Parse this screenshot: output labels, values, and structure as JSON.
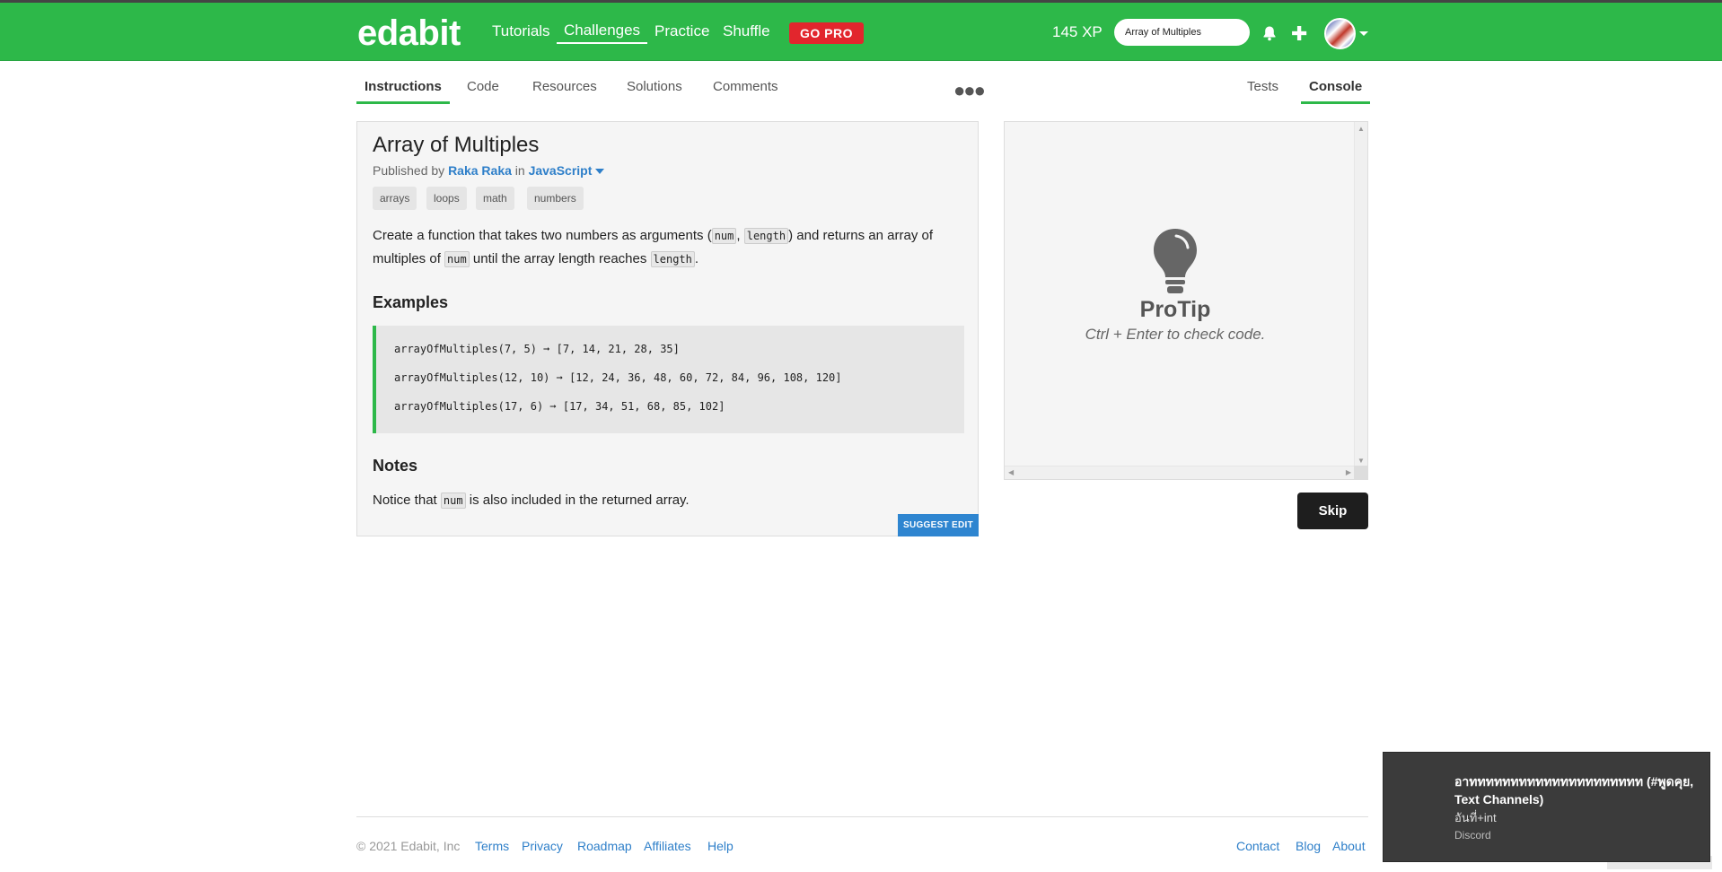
{
  "nav": {
    "logo": "edabit",
    "links": [
      "Tutorials",
      "Challenges",
      "Practice",
      "Shuffle"
    ],
    "active_link": "Challenges",
    "gopro": "GO PRO",
    "xp": "145 XP",
    "search_value": "Array of Multiples"
  },
  "tabs": {
    "left": [
      "Instructions",
      "Code",
      "Resources",
      "Solutions",
      "Comments"
    ],
    "right": [
      "Tests",
      "Console"
    ],
    "active_left": "Instructions",
    "active_right": "Console"
  },
  "challenge": {
    "title": "Array of Multiples",
    "published_prefix": "Published by",
    "author": "Raka Raka",
    "in_word": "in",
    "language": "JavaScript",
    "tags": [
      "arrays",
      "loops",
      "math",
      "numbers"
    ],
    "desc": {
      "p1": "Create a function that takes two numbers as arguments (",
      "c1": "num",
      "p2": ", ",
      "c2": "length",
      "p3": ") and returns an array of multiples of ",
      "c3": "num",
      "p4": " until the array length reaches ",
      "c4": "length",
      "p5": "."
    },
    "examples_heading": "Examples",
    "examples": [
      "arrayOfMultiples(7, 5) ➞ [7, 14, 21, 28, 35]",
      "arrayOfMultiples(12, 10) ➞ [12, 24, 36, 48, 60, 72, 84, 96, 108, 120]",
      "arrayOfMultiples(17, 6) ➞ [17, 34, 51, 68, 85, 102]"
    ],
    "notes_heading": "Notes",
    "notes": {
      "p1": "Notice that ",
      "c1": "num",
      "p2": " is also included in the returned array."
    },
    "suggest_edit": "SUGGEST EDIT"
  },
  "console": {
    "protip": "ProTip",
    "protip_sub": "Ctrl + Enter to check code.",
    "skip": "Skip"
  },
  "footer": {
    "copyright": "© 2021 Edabit, Inc",
    "links_left": [
      "Terms",
      "Privacy",
      "Roadmap",
      "Affiliates",
      "Help"
    ],
    "links_right": [
      "Contact",
      "Blog",
      "About"
    ]
  },
  "toast": {
    "title": "อาททททททททททททททททททททท (#พูดคุย, Text Channels)",
    "subtitle": "อันที่+int",
    "app": "Discord"
  },
  "colors": {
    "brand_green": "#2db849",
    "link_blue": "#2e7fc9",
    "gopro_red": "#e2262d"
  }
}
